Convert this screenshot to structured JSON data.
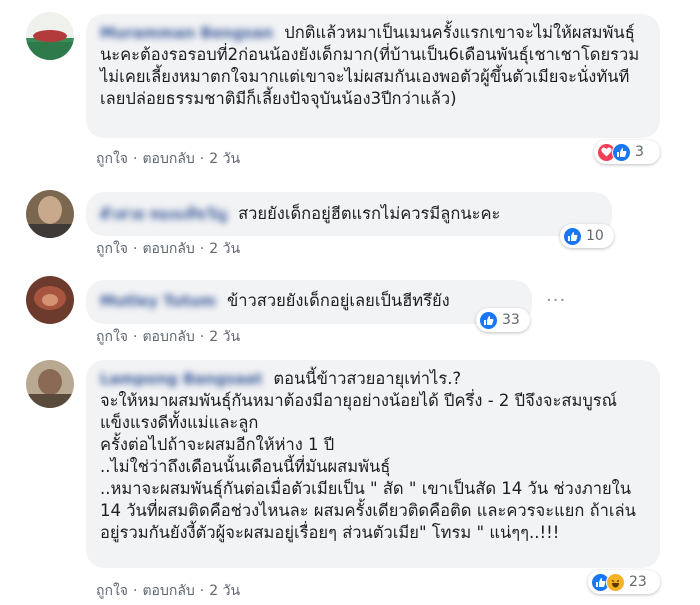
{
  "actions": {
    "like": "ถูกใจ",
    "reply": "ตอบกลับ",
    "dot": "·"
  },
  "comments": [
    {
      "author": "Muramman Bengsan",
      "text": "ปกติแล้วหมาเป็นเมนครั้งแรกเขาจะไม่ให้ผสมพันธุ์นะคะต้องรอรอบที่2ก่อนน้องยังเด็กมาก(ที่บ้านเป็น6เดือนพันธุ์เชาเชาโดยรวมไม่เคยเลี้ยงหมาตกใจมากแต่เขาจะไม่ผสมกันเองพอตัวผู้ขึ้นตัวเมียจะนั่งทันทีเลยปล่อยธรรมชาติมีก็เลี้ยงปัจจุบันน้อง3ปีกว่าแล้ว)",
      "time": "2 วัน",
      "reactions": {
        "icons": [
          "love",
          "like"
        ],
        "count": "3"
      }
    },
    {
      "author": "ตัวสวย ทองแท้ขวัญ",
      "text": "สวยยังเด็กอยู่ฮีตแรกไม่ควรมีลูกนะคะ",
      "time": "2 วัน",
      "reactions": {
        "icons": [
          "like"
        ],
        "count": "10"
      }
    },
    {
      "author": "Mutley Tutum",
      "text": "ข้าวสวยยังเด็กอยู่เลยเป็นฮีทรึยัง",
      "time": "2 วัน",
      "reactions": {
        "icons": [
          "like"
        ],
        "count": "33"
      }
    },
    {
      "author": "Lampong Bangsaat",
      "text": "ตอนนี้ข้าวสวยอายุเท่าไร.?\nจะให้หมาผสมพันธุ์กันหมาต้องมีอายุอย่างน้อยได้ ปีครึ่ง - 2 ปีจึงจะสมบูรณ์แข็งแรงดีทั้งแม่และลูก\nครั้งต่อไปถ้าจะผสมอีกให้ห่าง 1 ปี\n..ไม่ใช่ว่าถึงเดือนนั้นเดือนนี้ที่มันผสมพันธุ์\n..หมาจะผสมพันธุ์กันต่อเมื่อตัวเมียเป็น \" สัด \" เขาเป็นสัด 14 วัน ช่วงภายใน 14 วันที่ผสมติดคือช่วงไหนละ ผสมครั้งเดียวติดคือติด และควรจะแยก ถ้าเล่นอยู่รวมกันยังงี้ตัวผู้จะผสมอยู่เรื่อยๆ ส่วนตัวเมีย\" โทรม \" แน่ๆๆ..!!!",
      "time": "2 วัน",
      "reactions": {
        "icons": [
          "like",
          "haha"
        ],
        "count": "23"
      }
    }
  ],
  "colors": {
    "link": "#385898",
    "like": "#1877f2",
    "love": "#f33e58",
    "haha": "#f7b125",
    "bubble": "#f2f3f5"
  }
}
